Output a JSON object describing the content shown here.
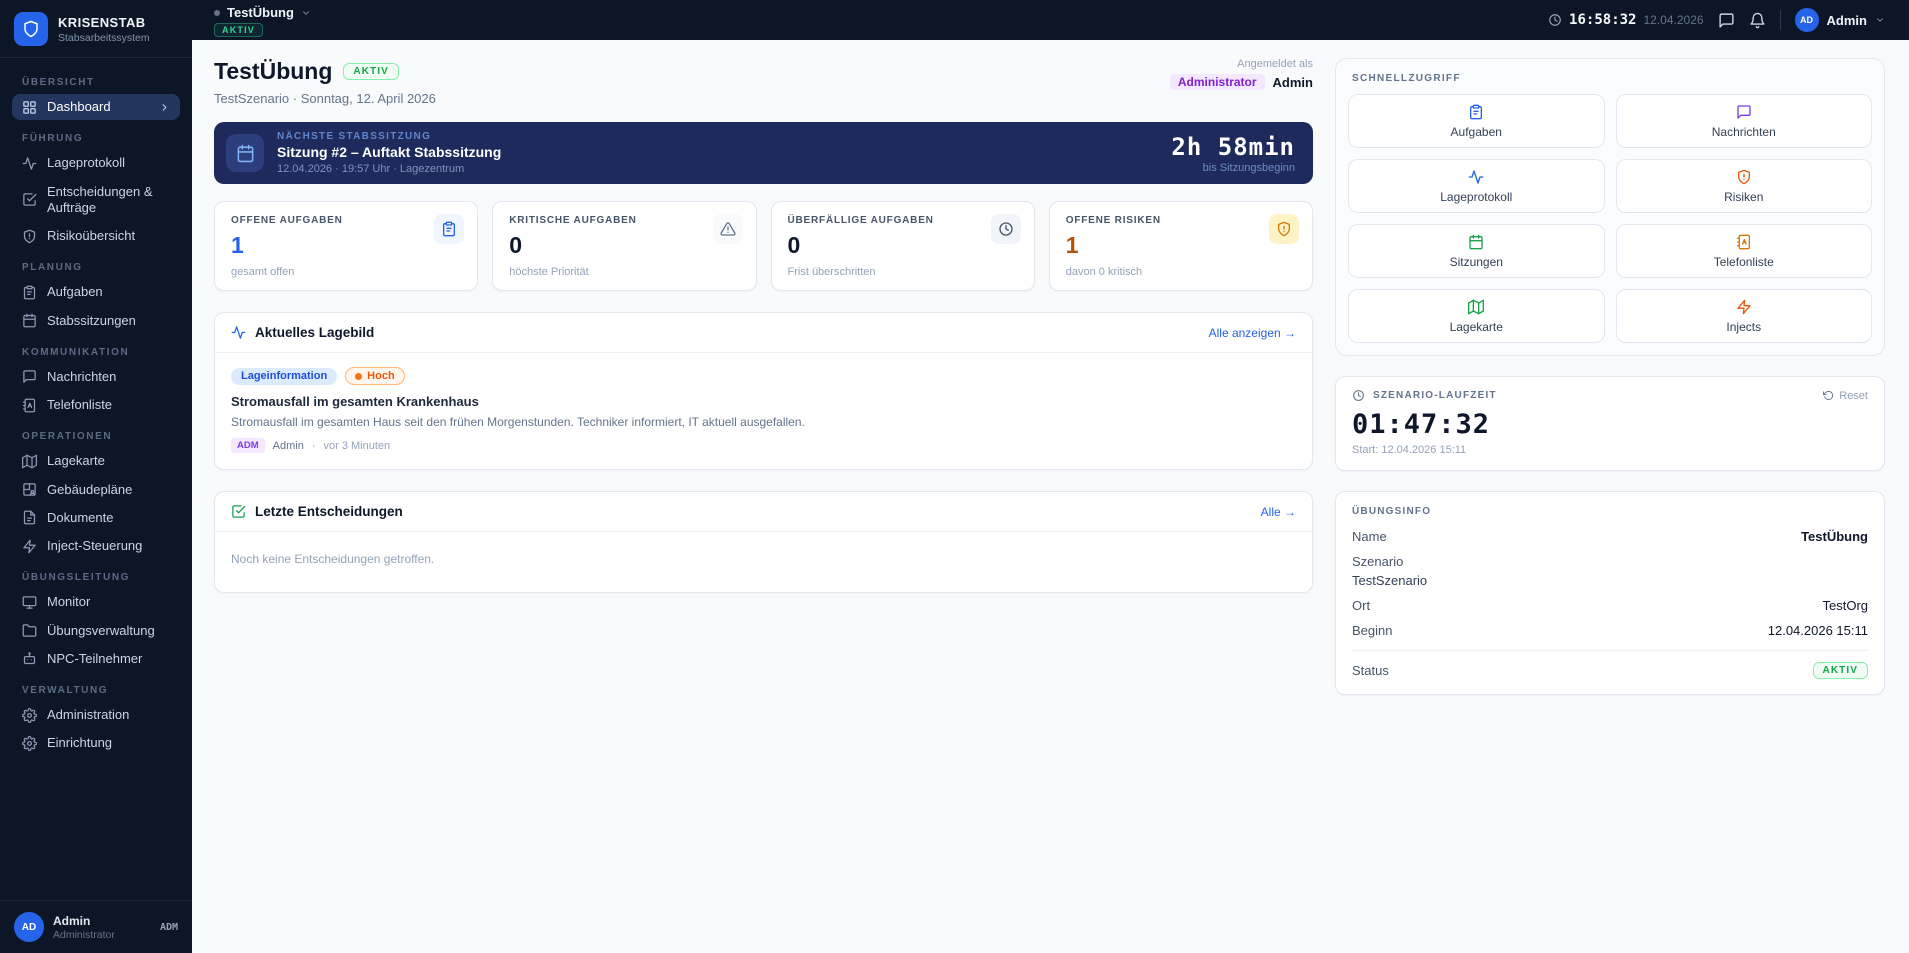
{
  "app": {
    "name": "KRISENSTAB",
    "subtitle": "Stabsarbeitssystem"
  },
  "topbar": {
    "exercise": "TestÜbung",
    "status": "AKTIV",
    "time": "16:58:32",
    "date": "12.04.2026",
    "user_initials": "AD",
    "user_name": "Admin"
  },
  "sidebar": {
    "sections": [
      {
        "label": "ÜBERSICHT",
        "items": [
          {
            "label": "Dashboard",
            "icon": "dashboard-icon"
          }
        ]
      },
      {
        "label": "FÜHRUNG",
        "items": [
          {
            "label": "Lageprotokoll",
            "icon": "activity-icon"
          },
          {
            "label": "Entscheidungen & Aufträge",
            "icon": "check-square-icon"
          },
          {
            "label": "Risikoübersicht",
            "icon": "shield-alert-icon"
          }
        ]
      },
      {
        "label": "PLANUNG",
        "items": [
          {
            "label": "Aufgaben",
            "icon": "clipboard-icon"
          },
          {
            "label": "Stabssitzungen",
            "icon": "calendar-icon"
          }
        ]
      },
      {
        "label": "KOMMUNIKATION",
        "items": [
          {
            "label": "Nachrichten",
            "icon": "message-icon"
          },
          {
            "label": "Telefonliste",
            "icon": "contact-book-icon"
          }
        ]
      },
      {
        "label": "OPERATIONEN",
        "items": [
          {
            "label": "Lagekarte",
            "icon": "map-icon"
          },
          {
            "label": "Gebäudepläne",
            "icon": "building-plan-icon"
          },
          {
            "label": "Dokumente",
            "icon": "document-icon"
          },
          {
            "label": "Inject-Steuerung",
            "icon": "zap-icon"
          }
        ]
      },
      {
        "label": "ÜBUNGSLEITUNG",
        "items": [
          {
            "label": "Monitor",
            "icon": "monitor-icon"
          },
          {
            "label": "Übungsverwaltung",
            "icon": "folder-icon"
          },
          {
            "label": "NPC-Teilnehmer",
            "icon": "robot-icon"
          }
        ]
      },
      {
        "label": "VERWALTUNG",
        "items": [
          {
            "label": "Administration",
            "icon": "gear-icon"
          },
          {
            "label": "Einrichtung",
            "icon": "gear-icon"
          }
        ]
      }
    ],
    "user": {
      "initials": "AD",
      "name": "Admin",
      "role": "Administrator",
      "badge": "ADM"
    }
  },
  "header": {
    "title": "TestÜbung",
    "status": "AKTIV",
    "subtitle": "TestSzenario · Sonntag, 12. April 2026",
    "signed_in_label": "Angemeldet als",
    "role_badge": "Administrator",
    "user_name": "Admin"
  },
  "session_banner": {
    "kicker": "NÄCHSTE STABSSITZUNG",
    "title": "Sitzung #2 – Auftakt Stabssitzung",
    "details": "12.04.2026 · 19:57 Uhr · Lagezentrum",
    "countdown": "2h 58min",
    "countdown_label": "bis Sitzungsbeginn"
  },
  "stats": [
    {
      "label": "OFFENE AUFGABEN",
      "value": "1",
      "sub": "gesamt offen",
      "icon": "clipboard-icon",
      "accent": "#2563eb"
    },
    {
      "label": "KRITISCHE AUFGABEN",
      "value": "0",
      "sub": "höchste Priorität",
      "icon": "alert-triangle-icon",
      "accent": "#0f172a"
    },
    {
      "label": "ÜBERFÄLLIGE AUFGABEN",
      "value": "0",
      "sub": "Frist überschritten",
      "icon": "clock-icon",
      "accent": "#0f172a"
    },
    {
      "label": "OFFENE RISIKEN",
      "value": "1",
      "sub": "davon 0 kritisch",
      "icon": "shield-alert-icon",
      "accent": "#b45309"
    }
  ],
  "lagebild": {
    "title": "Aktuelles Lagebild",
    "link": "Alle anzeigen →",
    "entry": {
      "type_badge": "Lageinformation",
      "priority_badge": "Hoch",
      "title": "Stromausfall im gesamten Krankenhaus",
      "description": "Stromausfall im gesamten Haus seit den frühen Morgenstunden. Techniker informiert, IT aktuell ausgefallen.",
      "author_badge": "ADM",
      "author": "Admin",
      "separator": "·",
      "time_ago": "vor 3 Minuten"
    }
  },
  "entscheidungen": {
    "title": "Letzte Entscheidungen",
    "link": "Alle →",
    "empty_text": "Noch keine Entscheidungen getroffen."
  },
  "quick_access": {
    "title": "SCHNELLZUGRIFF",
    "tiles": [
      {
        "label": "Aufgaben",
        "icon": "clipboard-icon",
        "color": "#2563eb"
      },
      {
        "label": "Nachrichten",
        "icon": "message-icon",
        "color": "#7c3aed"
      },
      {
        "label": "Lageprotokoll",
        "icon": "activity-icon",
        "color": "#2563eb"
      },
      {
        "label": "Risiken",
        "icon": "shield-alert-icon",
        "color": "#ea580c"
      },
      {
        "label": "Sitzungen",
        "icon": "calendar-icon",
        "color": "#16a34a"
      },
      {
        "label": "Telefonliste",
        "icon": "contact-book-icon",
        "color": "#d97706"
      },
      {
        "label": "Lagekarte",
        "icon": "map-icon",
        "color": "#16a34a"
      },
      {
        "label": "Injects",
        "icon": "zap-icon",
        "color": "#ea580c"
      }
    ]
  },
  "runtime": {
    "title": "SZENARIO-LAUFZEIT",
    "reset_label": "Reset",
    "value": "01:47:32",
    "start": "Start: 12.04.2026 15:11"
  },
  "uebungsinfo": {
    "title": "ÜBUNGSINFO",
    "rows": [
      {
        "label": "Name",
        "value": "TestÜbung"
      },
      {
        "label": "Szenario",
        "value": "TestSzenario"
      },
      {
        "label": "Ort",
        "value": "TestOrg"
      },
      {
        "label": "Beginn",
        "value": "12.04.2026 15:11"
      }
    ],
    "status_label": "Status",
    "status_value": "AKTIV"
  }
}
